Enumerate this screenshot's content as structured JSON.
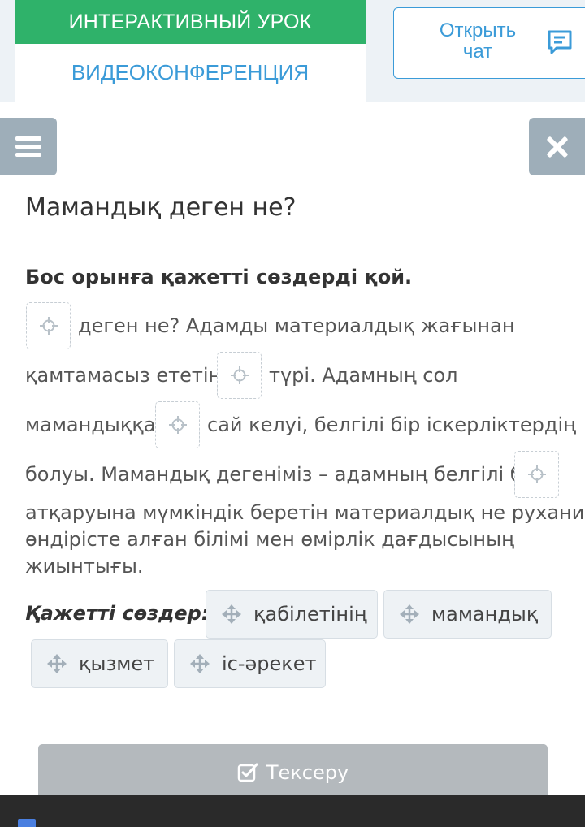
{
  "header": {
    "interactive_lesson": "ИНТЕРАКТИВНЫЙ УРОК",
    "video_conference": "ВИДЕОКОНФЕРЕНЦИЯ",
    "open_chat": [
      "Открыть",
      "чат"
    ]
  },
  "toolbar": {
    "menu_icon": "hamburger-icon",
    "close_icon": "close-x-icon"
  },
  "task": {
    "title": "Мамандық деген не?",
    "instruction": "Бос орынға қажетті сөздерді қой.",
    "text": {
      "p1": "деген не? Адамды материалдық жағынан",
      "p2": "қамтамасыз ететін",
      "p3": "түрі. Адамның сол",
      "p4": "мамандыққа",
      "p5": "сай келуі, белгілі бір іскерліктердің",
      "p6": "болуы. Мамандық дегеніміз – адамның белгілі бір",
      "p7": " атқаруына мүмкіндік беретін материалдық не рухани",
      "p8": "өндірісте алған білімі мен өмірлік дағдысының",
      "p9": "жиынтығы."
    },
    "words_label": "Қажетті сөздер:",
    "words": [
      "қабілетінің",
      "мамандық",
      "қызмет",
      "іс-әрекет"
    ]
  },
  "check_button": "Тексеру",
  "colors": {
    "green": "#2fb26a",
    "blue": "#3b9bd8",
    "grey_button": "#9eaeb9",
    "check_button": "#b4b9bd"
  }
}
